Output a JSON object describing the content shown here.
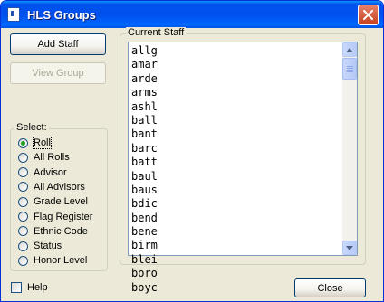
{
  "window": {
    "title": "HLS Groups"
  },
  "buttons": {
    "add_staff": "Add Staff",
    "view_group": "View Group",
    "close": "Close"
  },
  "select_group": {
    "legend": "Select:",
    "options": [
      "Roll",
      "All Rolls",
      "Advisor",
      "All Advisors",
      "Grade Level",
      "Flag Register",
      "Ethnic Code",
      "Status",
      "Honor Level"
    ],
    "selected": "Roll"
  },
  "current_staff": {
    "legend": "Current Staff",
    "items": [
      "allg",
      "amar",
      "arde",
      "arms",
      "ashl",
      "ball",
      "bant",
      "barc",
      "batt",
      "baul",
      "baus",
      "bdic",
      "bend",
      "bene",
      "birm",
      "blei",
      "boro",
      "boyc"
    ]
  },
  "help": {
    "label": "Help",
    "checked": false
  },
  "icons": [
    "app-icon",
    "close-icon",
    "scroll-up-icon",
    "scroll-down-icon"
  ]
}
